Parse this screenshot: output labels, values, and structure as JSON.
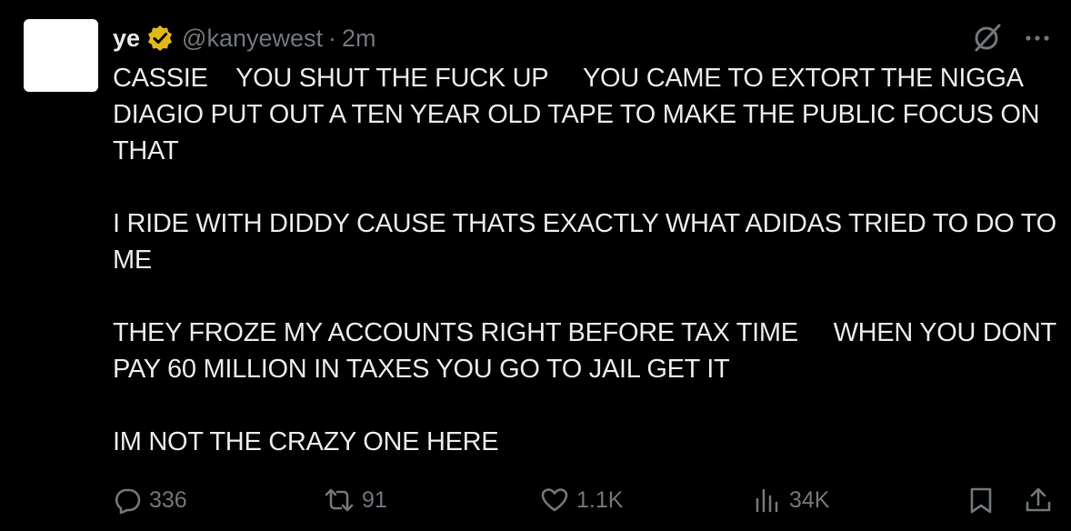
{
  "tweet": {
    "author_name": "ye",
    "handle": "@kanyewest",
    "separator": "·",
    "time": "2m",
    "paragraphs": [
      "CASSIE    YOU SHUT THE FUCK UP     YOU CAME TO EXTORT THE NIGGA DIAGIO PUT OUT A TEN YEAR OLD TAPE TO MAKE THE PUBLIC FOCUS ON THAT",
      "I RIDE WITH DIDDY CAUSE THATS EXACTLY WHAT ADIDAS TRIED TO DO TO ME",
      "THEY FROZE MY ACCOUNTS RIGHT BEFORE TAX TIME     WHEN YOU DONT PAY 60 MILLION IN TAXES YOU GO TO JAIL GET IT",
      "IM NOT THE CRAZY ONE HERE"
    ]
  },
  "actions": {
    "replies": "336",
    "reposts": "91",
    "likes": "1.1K",
    "views": "34K"
  },
  "icons": {
    "verified": "verified-badge-icon",
    "grok": "grok-icon",
    "more": "more-icon",
    "reply": "reply-icon",
    "repost": "repost-icon",
    "like": "heart-icon",
    "views": "views-icon",
    "bookmark": "bookmark-icon",
    "share": "share-icon"
  },
  "colors": {
    "background": "#000000",
    "text": "#e7e9ea",
    "muted": "#71767b",
    "verified_gold": "#e2b719"
  }
}
